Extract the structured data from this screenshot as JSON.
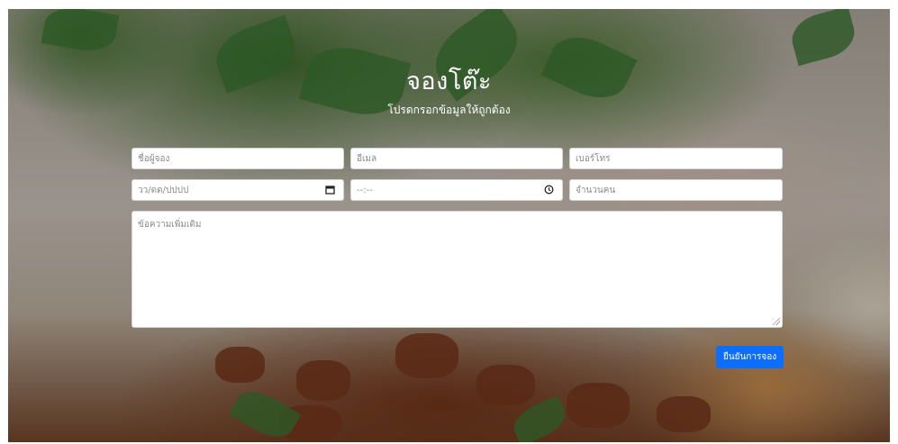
{
  "header": {
    "title": "จองโต๊ะ",
    "subtitle": "โปรดกรอกข้อมูลให้ถูกต้อง"
  },
  "form": {
    "name_placeholder": "ชื่อผู้จอง",
    "email_placeholder": "อีเมล",
    "phone_placeholder": "เบอร์โทร",
    "date_placeholder": "วว/ดด/ปปปป",
    "time_placeholder": "--:--",
    "guests_placeholder": "จำนวนคน",
    "message_placeholder": "ข้อความเพิ่มเติม",
    "submit_label": "ยืนยันการจอง"
  },
  "icons": {
    "date": "calendar-icon",
    "time": "clock-icon"
  },
  "colors": {
    "accent": "#0d6efd",
    "overlay": "rgba(0,0,0,0.28)"
  }
}
